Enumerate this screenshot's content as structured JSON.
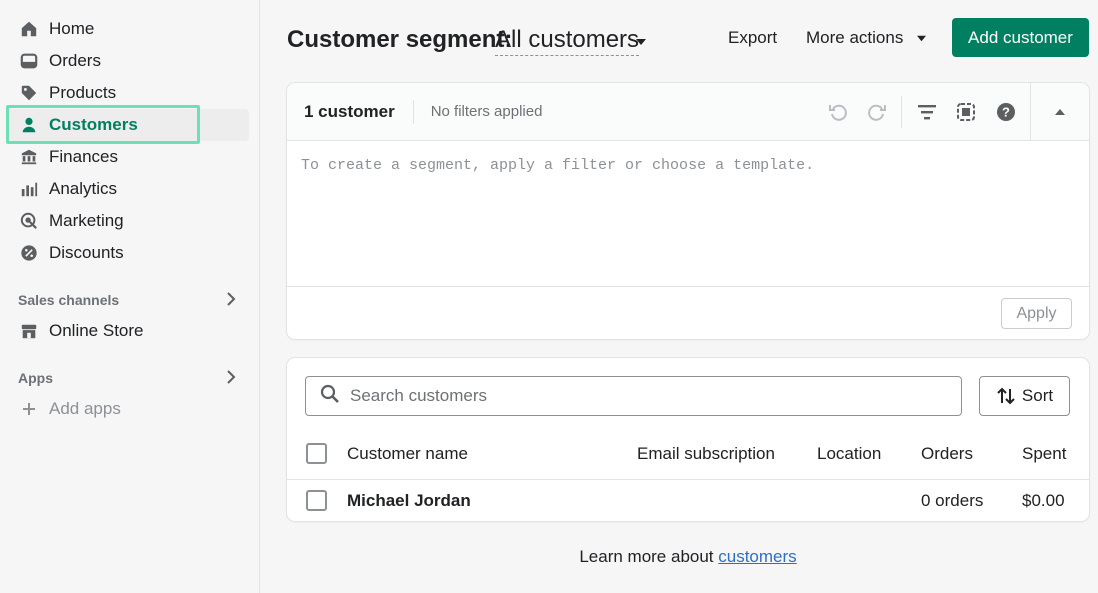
{
  "sidebar": {
    "items": [
      {
        "label": "Home",
        "icon": "home-icon"
      },
      {
        "label": "Orders",
        "icon": "orders-icon"
      },
      {
        "label": "Products",
        "icon": "tag-icon"
      },
      {
        "label": "Customers",
        "icon": "person-icon",
        "active": true
      },
      {
        "label": "Finances",
        "icon": "bank-icon"
      },
      {
        "label": "Analytics",
        "icon": "bar-chart-icon"
      },
      {
        "label": "Marketing",
        "icon": "target-icon"
      },
      {
        "label": "Discounts",
        "icon": "discount-icon"
      }
    ],
    "sales_channels_label": "Sales channels",
    "online_store_label": "Online Store",
    "apps_label": "Apps",
    "add_apps_label": "Add apps"
  },
  "header": {
    "segment_label": "Customer segment:",
    "segment_value": "All customers",
    "export_label": "Export",
    "more_actions_label": "More actions",
    "add_customer_label": "Add customer"
  },
  "segment_card": {
    "count": "1 customer",
    "filter_status": "No filters applied",
    "editor_placeholder": "To create a segment, apply a filter or choose a template.",
    "apply_label": "Apply"
  },
  "customers_table": {
    "search_placeholder": "Search customers",
    "sort_label": "Sort",
    "columns": [
      "Customer name",
      "Email subscription",
      "Location",
      "Orders",
      "Spent"
    ],
    "rows": [
      {
        "name": "Michael Jordan",
        "email_subscription": "",
        "location": "",
        "orders": "0 orders",
        "spent": "$0.00"
      }
    ]
  },
  "footer": {
    "text": "Learn more about ",
    "link": "customers"
  },
  "colors": {
    "accent": "#008060",
    "highlight": "#6fe0b5",
    "link": "#2c6ecb"
  }
}
